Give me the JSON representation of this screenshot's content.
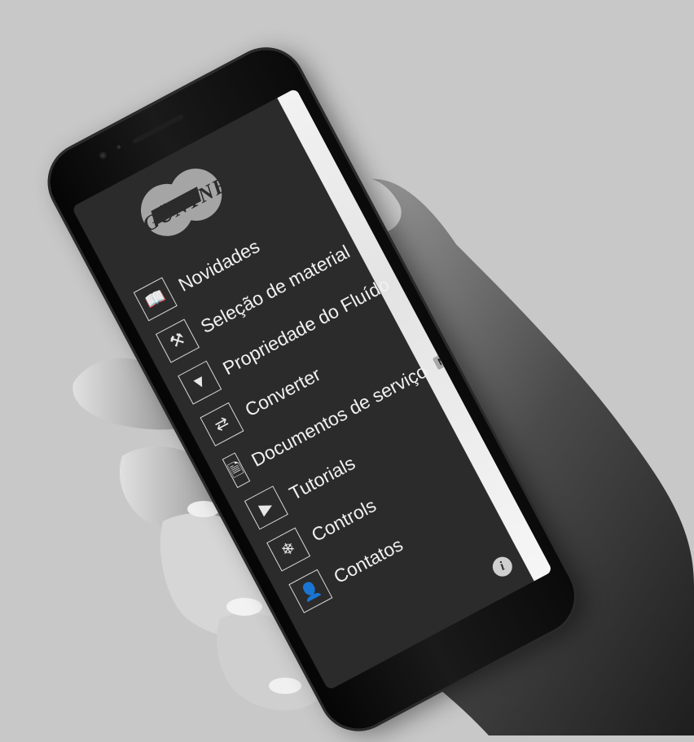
{
  "app": {
    "brand": "GÜNTNER"
  },
  "menu": {
    "items": [
      {
        "label": "Novidades",
        "icon": "book-icon"
      },
      {
        "label": "Seleção de material",
        "icon": "material-tools-icon"
      },
      {
        "label": "Propriedade do Fluído",
        "icon": "fluid-chart-icon"
      },
      {
        "label": "Converter",
        "icon": "converter-icon"
      },
      {
        "label": "Documentos de serviço",
        "icon": "service-doc-icon"
      },
      {
        "label": "Tutorials",
        "icon": "tutorial-video-icon"
      },
      {
        "label": "Controls",
        "icon": "fan-icon"
      },
      {
        "label": "Contatos",
        "icon": "person-icon"
      }
    ],
    "badge": "NEW"
  },
  "info_icon": "i",
  "colors": {
    "background": "#c8c8c8",
    "screen": "#2b2b2b",
    "text": "#f0f0f0"
  }
}
